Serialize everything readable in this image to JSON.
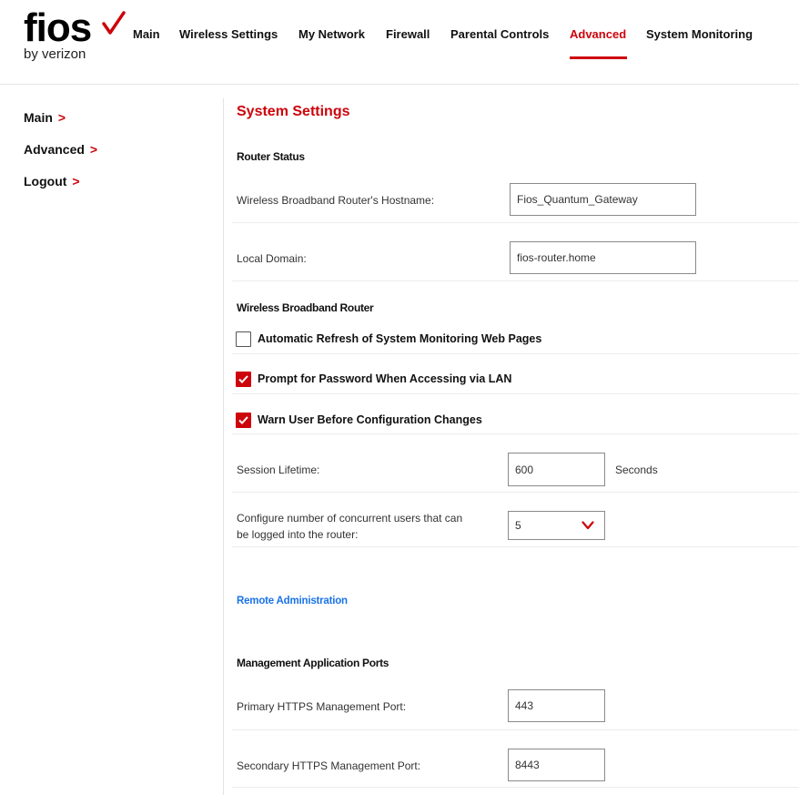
{
  "brand": {
    "logo_text": "fios",
    "sub_text": "by verizon",
    "accent_color": "#cd040b"
  },
  "topnav": {
    "items": [
      {
        "label": "Main"
      },
      {
        "label": "Wireless Settings"
      },
      {
        "label": "My Network"
      },
      {
        "label": "Firewall"
      },
      {
        "label": "Parental Controls"
      },
      {
        "label": "Advanced"
      },
      {
        "label": "System Monitoring"
      }
    ],
    "active": "Advanced"
  },
  "sidebar": {
    "items": [
      {
        "label": "Main",
        "chevron": ">"
      },
      {
        "label": "Advanced",
        "chevron": ">"
      },
      {
        "label": "Logout",
        "chevron": ">"
      }
    ]
  },
  "page": {
    "title": "System Settings",
    "router_status": {
      "heading": "Router Status",
      "hostname_label": "Wireless Broadband Router's Hostname:",
      "hostname_value": "Fios_Quantum_Gateway",
      "domain_label": "Local Domain:",
      "domain_value": "fios-router.home"
    },
    "wbr": {
      "heading": "Wireless Broadband Router",
      "checkboxes": [
        {
          "label": "Automatic Refresh of System Monitoring Web Pages",
          "checked": false
        },
        {
          "label": "Prompt for Password When Accessing via LAN",
          "checked": true
        },
        {
          "label": "Warn User Before Configuration Changes",
          "checked": true
        }
      ],
      "session_label": "Session Lifetime:",
      "session_value": "600",
      "session_unit": "Seconds",
      "users_label_line1": "Configure number of concurrent users that can",
      "users_label_line2": "be logged into the router:",
      "users_value": "5"
    },
    "remote_admin_link": "Remote Administration",
    "ports": {
      "heading": "Management Application Ports",
      "primary_label": "Primary HTTPS Management Port:",
      "primary_value": "443",
      "secondary_label": "Secondary HTTPS Management Port:",
      "secondary_value": "8443"
    }
  }
}
